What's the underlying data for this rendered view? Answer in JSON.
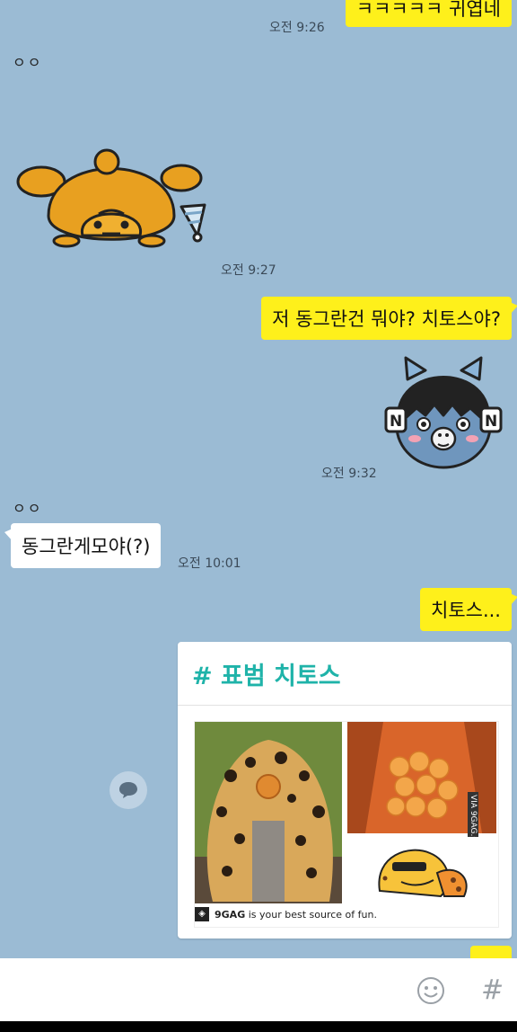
{
  "messages": [
    {
      "id": "m1",
      "text": "ㅋㅋㅋㅋㅋ 귀엽네",
      "time": "오전 9:26"
    },
    {
      "id": "sender1",
      "name": "ㅇㅇ"
    },
    {
      "id": "sticker1",
      "time": "오전 9:27"
    },
    {
      "id": "m2",
      "text": "저 동그란건 뭐야? 치토스야?"
    },
    {
      "id": "sticker2",
      "time": "오전 9:32"
    },
    {
      "id": "sender2",
      "name": "ㅇㅇ"
    },
    {
      "id": "m3",
      "text": "동그란게모야(?)",
      "time": "오전 10:01"
    },
    {
      "id": "m4",
      "text": "치토스..."
    }
  ],
  "card": {
    "title": "# 표범 치토스",
    "caption_brand": "9GAG",
    "caption_text": " is your best source of fun.",
    "via_text": "VIA 9GAG.COM"
  },
  "input": {
    "emoji_icon": "emoji-icon",
    "hash_label": "#"
  },
  "colors": {
    "background": "#9bbbd4",
    "my_bubble": "#fef01b",
    "their_bubble": "#ffffff",
    "card_title": "#1fb3a9"
  }
}
